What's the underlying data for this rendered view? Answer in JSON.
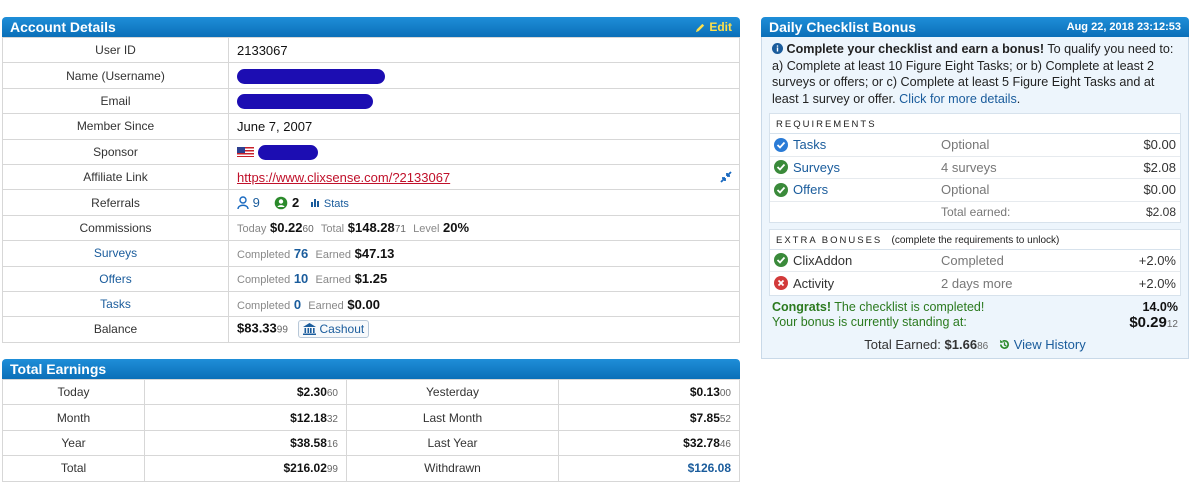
{
  "account": {
    "title": "Account Details",
    "edit_label": "Edit",
    "labels": {
      "user_id": "User ID",
      "name": "Name (Username)",
      "email": "Email",
      "member_since": "Member Since",
      "sponsor": "Sponsor",
      "affiliate_link": "Affiliate Link",
      "referrals": "Referrals",
      "commissions": "Commissions",
      "surveys": "Surveys",
      "offers": "Offers",
      "tasks": "Tasks",
      "balance": "Balance"
    },
    "user_id": "2133067",
    "member_since": "June 7, 2007",
    "affiliate_link": "https://www.clixsense.com/?2133067",
    "referrals": {
      "count_a": "9",
      "count_b": "2",
      "stats_label": "Stats"
    },
    "commissions": {
      "today_label": "Today",
      "today_value": "$0.22",
      "today_cents": "60",
      "total_label": "Total",
      "total_value": "$148.28",
      "total_cents": "71",
      "level_label": "Level",
      "level_value": "20%"
    },
    "surveys": {
      "completed_label": "Completed",
      "completed": "76",
      "earned_label": "Earned",
      "earned": "$47.13"
    },
    "offers": {
      "completed_label": "Completed",
      "completed": "10",
      "earned_label": "Earned",
      "earned": "$1.25"
    },
    "tasks": {
      "completed_label": "Completed",
      "completed": "0",
      "earned_label": "Earned",
      "earned": "$0.00"
    },
    "balance": {
      "value": "$83.33",
      "cents": "99",
      "cashout_label": "Cashout"
    }
  },
  "earnings": {
    "title": "Total Earnings",
    "rows": [
      {
        "l1": "Today",
        "v1": "$2.30",
        "c1": "60",
        "l2": "Yesterday",
        "v2": "$0.13",
        "c2": "00"
      },
      {
        "l1": "Month",
        "v1": "$12.18",
        "c1": "32",
        "l2": "Last Month",
        "v2": "$7.85",
        "c2": "52"
      },
      {
        "l1": "Year",
        "v1": "$38.58",
        "c1": "16",
        "l2": "Last Year",
        "v2": "$32.78",
        "c2": "46"
      },
      {
        "l1": "Total",
        "v1": "$216.02",
        "c1": "99",
        "l2": "Withdrawn",
        "v2": "$126.08",
        "c2": ""
      }
    ]
  },
  "checklist": {
    "title": "Daily Checklist Bonus",
    "date": "Aug 22, 2018 23:12:53",
    "intro_bold": "Complete your checklist and earn a bonus!",
    "intro_text": " To qualify you need to: a) Complete at least 10 Figure Eight Tasks; or b) Complete at least 2 surveys or offers; or c) Complete at least 5 Figure Eight Tasks and at least 1 survey or offer. ",
    "intro_link": "Click for more details",
    "requirements_title": "REQUIREMENTS",
    "requirements": [
      {
        "name": "Tasks",
        "status": "Optional",
        "amount": "$0.00"
      },
      {
        "name": "Surveys",
        "status": "4 surveys",
        "amount": "$2.08"
      },
      {
        "name": "Offers",
        "status": "Optional",
        "amount": "$0.00"
      }
    ],
    "total_earned_label": "Total earned:",
    "total_earned_value": "$2.08",
    "extra_title": "EXTRA BONUSES",
    "extra_note": "(complete the requirements to unlock)",
    "extras": [
      {
        "name": "ClixAddon",
        "status": "Completed",
        "amount": "+2.0%",
        "icon": "check-circle-icon"
      },
      {
        "name": "Activity",
        "status": "2 days more",
        "amount": "+2.0%",
        "icon": "x-circle-icon"
      }
    ],
    "congrats_bold": "Congrats!",
    "congrats_text": " The checklist is completed!",
    "standing_text": "Your bonus is currently standing at:",
    "bonus_percent": "14.0%",
    "bonus_value": "$0.29",
    "bonus_cents": "12",
    "total_label": "Total Earned:",
    "total_value": "$1.66",
    "total_cents": "86",
    "history_label": "View History"
  },
  "colors": {
    "header_blue": "#0b6fb8",
    "link_blue": "#1a5c9c",
    "green": "#2b7a1f",
    "red": "#c0102a",
    "redaction": "#1c0db2"
  }
}
